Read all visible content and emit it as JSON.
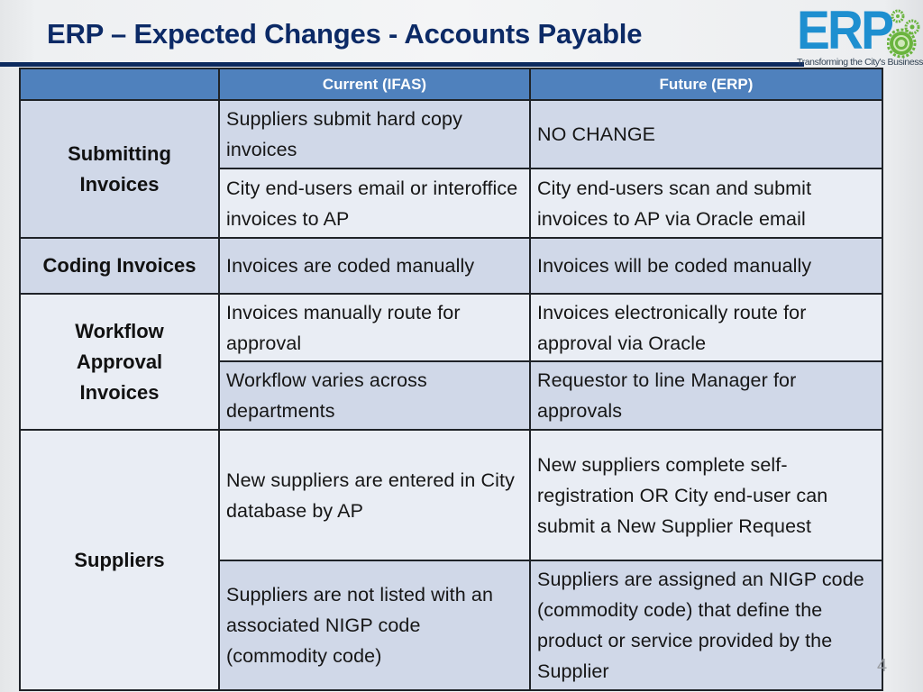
{
  "slide": {
    "title": "ERP – Expected Changes - Accounts Payable",
    "page_number": "4"
  },
  "logo": {
    "text": "ERP",
    "tagline": "Transforming the City's Business",
    "icon": "gears-icon",
    "colors": {
      "text": "#1e8fd0",
      "gears": "#6ab43e"
    }
  },
  "table": {
    "headers": [
      "",
      "Current (IFAS)",
      "Future (ERP)"
    ],
    "groups": [
      {
        "label": "Submitting Invoices",
        "rows": [
          {
            "current": "Suppliers submit hard copy invoices",
            "future": "NO CHANGE"
          },
          {
            "current": "City end-users email or interoffice invoices to AP",
            "future": "City end-users scan and submit invoices to AP via Oracle email"
          }
        ]
      },
      {
        "label": "Coding Invoices",
        "rows": [
          {
            "current": "Invoices are coded manually",
            "future": "Invoices will be coded manually"
          }
        ]
      },
      {
        "label": "Workflow Approval Invoices",
        "rows": [
          {
            "current": "Invoices manually route for approval",
            "future": "Invoices electronically route for approval via Oracle"
          },
          {
            "current": "Workflow varies across departments",
            "future": "Requestor to line Manager for approvals"
          }
        ]
      },
      {
        "label": "Suppliers",
        "rows": [
          {
            "current": "New suppliers are entered in City database by AP",
            "future": "New suppliers complete self-registration OR City end-user can submit a New Supplier Request"
          },
          {
            "current": "Suppliers are not listed with an associated NIGP code (commodity code)",
            "future": "Suppliers are assigned an NIGP code (commodity code) that define the product or service provided by the Supplier"
          }
        ]
      }
    ]
  },
  "colors": {
    "title": "#0c2a66",
    "header_bg": "#4f81bd",
    "band_dark": "#d0d8e8",
    "band_light": "#e9edf4"
  }
}
